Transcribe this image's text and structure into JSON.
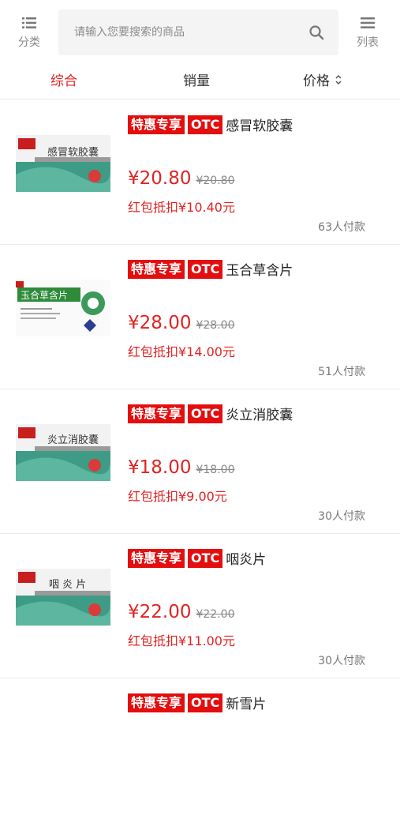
{
  "header": {
    "category_label": "分类",
    "list_label": "列表",
    "search_placeholder": "请输入您要搜索的商品"
  },
  "sort": {
    "comprehensive": "综合",
    "sales": "销量",
    "price": "价格"
  },
  "products": [
    {
      "tag_promo": "特惠专享",
      "tag_otc": "OTC",
      "name": "感冒软胶囊",
      "price": "¥20.80",
      "old_price": "¥20.80",
      "deduction": "红包抵扣¥10.40元",
      "paid": "63人付款",
      "box_text": "感冒软胶囊"
    },
    {
      "tag_promo": "特惠专享",
      "tag_otc": "OTC",
      "name": "玉合草含片",
      "price": "¥28.00",
      "old_price": "¥28.00",
      "deduction": "红包抵扣¥14.00元",
      "paid": "51人付款",
      "box_text": "玉合草含片"
    },
    {
      "tag_promo": "特惠专享",
      "tag_otc": "OTC",
      "name": "炎立消胶囊",
      "price": "¥18.00",
      "old_price": "¥18.00",
      "deduction": "红包抵扣¥9.00元",
      "paid": "30人付款",
      "box_text": "炎立消胶囊"
    },
    {
      "tag_promo": "特惠专享",
      "tag_otc": "OTC",
      "name": "咽炎片",
      "price": "¥22.00",
      "old_price": "¥22.00",
      "deduction": "红包抵扣¥11.00元",
      "paid": "30人付款",
      "box_text": "咽 炎 片"
    },
    {
      "tag_promo": "特惠专享",
      "tag_otc": "OTC",
      "name": "新雪片"
    }
  ],
  "colors": {
    "accent": "#e12323",
    "tag_bg": "#e40e0e"
  }
}
